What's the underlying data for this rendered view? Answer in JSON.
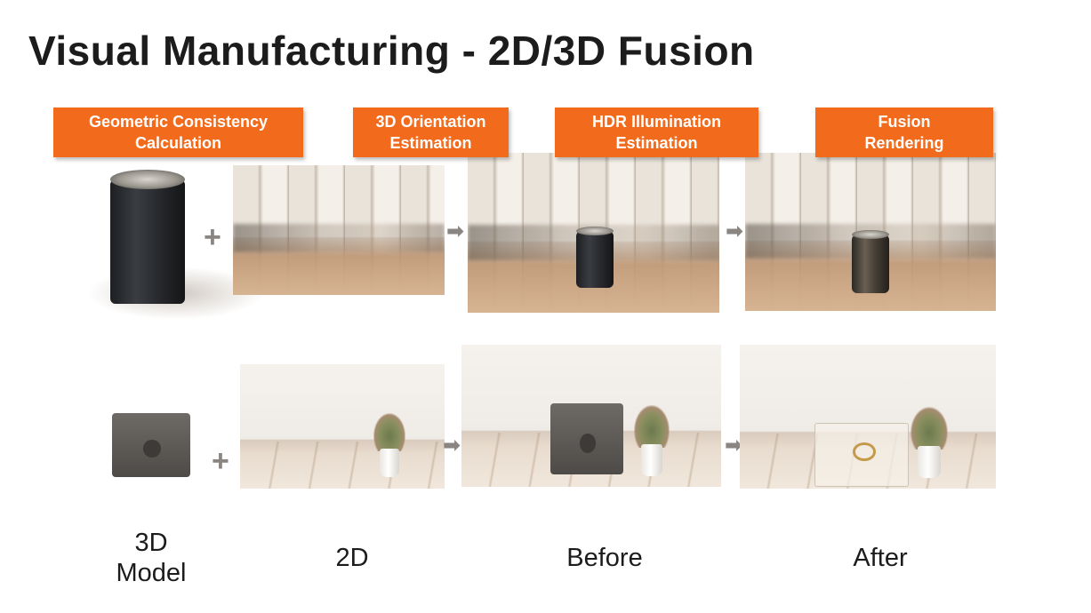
{
  "title": "Visual Manufacturing - 2D/3D Fusion",
  "steps": [
    {
      "line1": "Geometric Consistency",
      "line2": "Calculation"
    },
    {
      "line1": "3D Orientation",
      "line2": "Estimation"
    },
    {
      "line1": "HDR Illumination",
      "line2": "Estimation"
    },
    {
      "line1": "Fusion",
      "line2": "Rendering"
    }
  ],
  "captions": {
    "model_line1": "3D",
    "model_line2": "Model",
    "two_d": "2D",
    "before": "Before",
    "after": "After"
  },
  "symbols": {
    "plus": "+",
    "arrow": "➡"
  },
  "colors": {
    "tag_background": "#f26a1b",
    "tag_text": "#ffffff",
    "title_text": "#1c1c1c"
  }
}
